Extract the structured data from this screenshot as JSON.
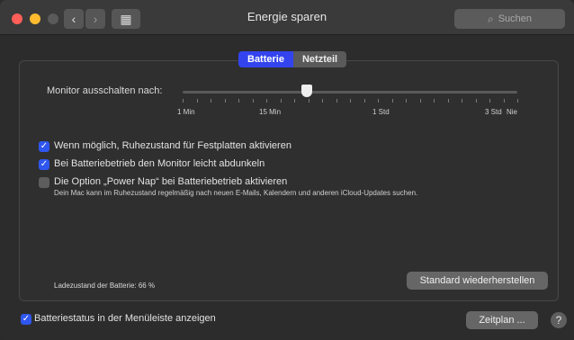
{
  "window": {
    "title": "Energie sparen"
  },
  "toolbar": {
    "back_glyph": "‹",
    "forward_glyph": "›",
    "grid_glyph": "▦",
    "search_placeholder": "Suchen",
    "search_icon": "⌕"
  },
  "tabs": [
    {
      "label": "Batterie",
      "active": true
    },
    {
      "label": "Netzteil",
      "active": false
    }
  ],
  "display_sleep": {
    "label": "Monitor ausschalten nach:",
    "ticks": [
      "1 Min",
      "15 Min",
      "1 Std",
      "3 Std",
      "Nie"
    ],
    "value_fraction": 0.37
  },
  "options": [
    {
      "label": "Wenn möglich, Ruhezustand für Festplatten aktivieren",
      "checked": true,
      "check_glyph": "✓"
    },
    {
      "label": "Bei Batteriebetrieb den Monitor leicht abdunkeln",
      "checked": true,
      "check_glyph": "✓"
    },
    {
      "label": "Die Option „Power Nap“ bei Batteriebetrieb aktivieren",
      "checked": false,
      "check_glyph": ""
    }
  ],
  "power_nap_note": "Dein Mac kann im Ruhezustand regelmäßig nach neuen E-Mails, Kalendern und anderen iCloud-Updates suchen.",
  "battery_status": "Ladezustand der Batterie: 66 %",
  "restore_button": "Standard wiederherstellen",
  "menubar_option": {
    "label": "Batteriestatus in der Menüleiste anzeigen",
    "checked": true,
    "check_glyph": "✓"
  },
  "schedule_button": "Zeitplan ...",
  "help_glyph": "?",
  "colors": {
    "accent": "#3344ee",
    "checkbox_on": "#2f56ee",
    "close": "#ff5f57",
    "minimize": "#febc2e"
  }
}
